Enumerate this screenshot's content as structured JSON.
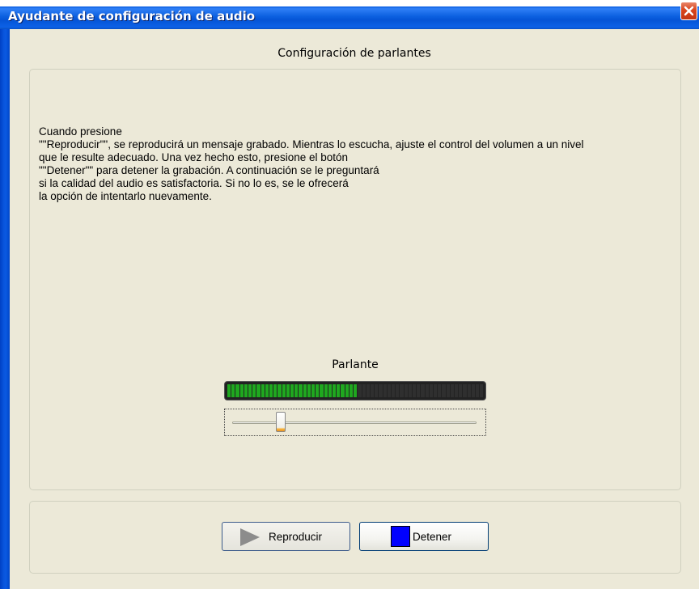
{
  "window": {
    "title": "Ayudante de configuración de audio",
    "close_icon": "close-icon",
    "title_color": "#0a5ee0"
  },
  "heading": "Configuración de parlantes",
  "instructions": {
    "lines": [
      "Cuando presione",
      "\"\"Reproducir\"\", se reproducirá un mensaje grabado.  Mientras lo escucha, ajuste el control del volumen a un nivel",
      " que le resulte adecuado.  Una vez hecho esto, presione el botón",
      " \"\"Detener\"\" para detener la grabación. A continuación se le preguntará",
      " si la calidad del audio es satisfactoria.  Si no lo es, se le ofrecerá",
      " la opción de intentarlo nuevamente."
    ]
  },
  "speaker": {
    "label": "Parlante",
    "meter_level": 0.5,
    "meter_segments": 61,
    "meter_active_color": "#1fa81f",
    "meter_inactive_color": "#2f2f2f",
    "volume_level": 0.2
  },
  "buttons": {
    "play_label": "Reproducir",
    "play_icon": "play-icon",
    "stop_label": "Detener",
    "stop_icon": "stop-icon",
    "stop_color": "#0000ff"
  }
}
